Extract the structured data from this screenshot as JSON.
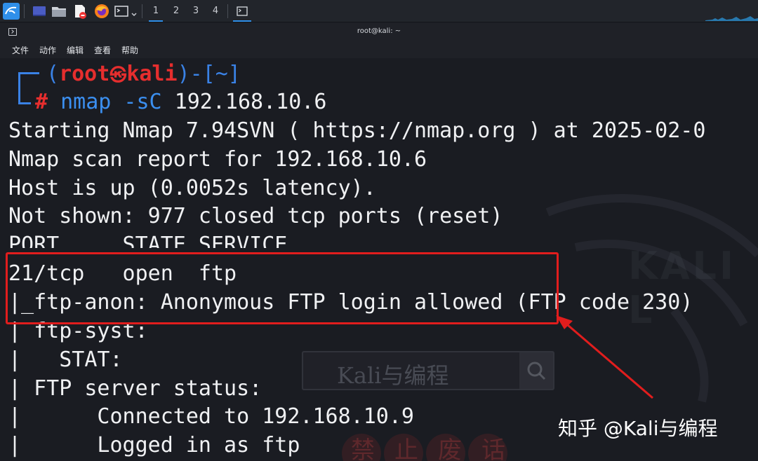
{
  "taskbar": {
    "icons": [
      "kali-menu-icon",
      "desktop-icon",
      "file-manager-icon",
      "text-editor-icon",
      "firefox-icon",
      "terminal-icon"
    ],
    "workspaces": [
      "1",
      "2",
      "3",
      "4"
    ],
    "active_workspace": "1"
  },
  "window": {
    "title": "root@kali: ~"
  },
  "menu": {
    "file": "文件",
    "actions": "动作",
    "edit": "编辑",
    "view": "查看",
    "help": "帮助"
  },
  "prompt": {
    "open": "┌──(",
    "user": "root",
    "at": "㉿",
    "host": "kali",
    "close": ")-[~]",
    "corner": "└─",
    "hash": "#",
    "cmd": "nmap -sC",
    "arg": "192.168.10.6"
  },
  "output": [
    "Starting Nmap 7.94SVN ( https://nmap.org ) at 2025-02-0",
    "Nmap scan report for 192.168.10.6",
    "Host is up (0.0052s latency).",
    "Not shown: 977 closed tcp ports (reset)",
    "PORT     STATE SERVICE",
    "21/tcp   open  ftp",
    "|_ftp-anon: Anonymous FTP login allowed (FTP code 230)",
    "| ftp-syst:",
    "|   STAT:",
    "| FTP server status:",
    "|      Connected to 192.168.10.9",
    "|      Logged in as ftp"
  ],
  "watermark": {
    "brand": "知乎 @Kali与编程",
    "search_box": "Kali与编程",
    "stamp": "禁止废话"
  },
  "colors": {
    "prompt_blue": "#3a82e6",
    "prompt_red": "#e62e2e",
    "highlight": "#e11d1d"
  }
}
